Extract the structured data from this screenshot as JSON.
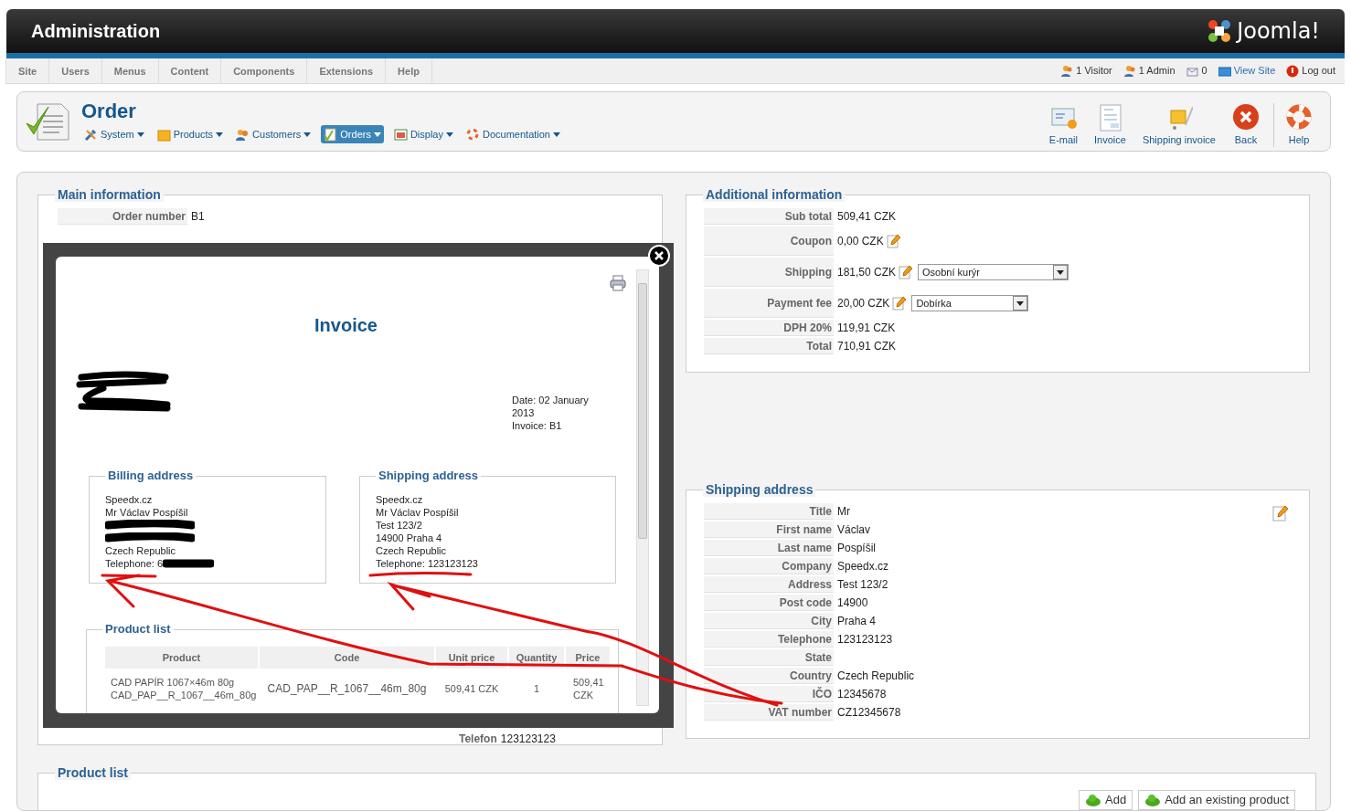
{
  "header": {
    "title": "Administration",
    "logo": "Joomla!"
  },
  "menu": [
    {
      "label": "Site"
    },
    {
      "label": "Users"
    },
    {
      "label": "Menus"
    },
    {
      "label": "Content"
    },
    {
      "label": "Components"
    },
    {
      "label": "Extensions"
    },
    {
      "label": "Help"
    }
  ],
  "status": [
    {
      "kind": "visitors",
      "label": "1 Visitor"
    },
    {
      "kind": "admins",
      "label": "1 Admin"
    },
    {
      "kind": "messages",
      "label": "0"
    },
    {
      "kind": "site",
      "label": "View Site"
    },
    {
      "kind": "logout",
      "label": "Log out"
    }
  ],
  "page": {
    "title": "Order",
    "submenu": [
      {
        "label": "System",
        "selected": false
      },
      {
        "label": "Products",
        "selected": false
      },
      {
        "label": "Customers",
        "selected": false
      },
      {
        "label": "Orders",
        "selected": true
      },
      {
        "label": "Display",
        "selected": false
      },
      {
        "label": "Documentation",
        "selected": false
      }
    ],
    "toolbar": [
      {
        "label": "E-mail"
      },
      {
        "label": "Invoice"
      },
      {
        "label": "Shipping invoice"
      },
      {
        "label": "Back"
      },
      {
        "label": "Help"
      }
    ]
  },
  "main_information": {
    "title": "Main information",
    "rows": [
      {
        "label": "Order number",
        "value": "B1"
      }
    ],
    "phone": {
      "label": "Telefon",
      "value": "123123123"
    }
  },
  "additional_information": {
    "title": "Additional information",
    "rows": [
      {
        "label": "Sub total",
        "value": "509,41 CZK",
        "editable": false
      },
      {
        "label": "Coupon",
        "value": "0,00 CZK",
        "editable": true
      },
      {
        "label": "Shipping",
        "value": "181,50 CZK",
        "editable": true,
        "select": "Osobní kurýr"
      },
      {
        "label": "Payment fee",
        "value": "20,00 CZK",
        "editable": true,
        "select": "Dobírka"
      },
      {
        "label": "DPH 20%",
        "value": "119,91 CZK",
        "editable": false
      },
      {
        "label": "Total",
        "value": "710,91 CZK",
        "editable": false
      }
    ]
  },
  "shipping_address": {
    "title": "Shipping address",
    "rows": [
      {
        "label": "Title",
        "value": "Mr"
      },
      {
        "label": "First name",
        "value": "Václav"
      },
      {
        "label": "Last name",
        "value": "Pospíšil"
      },
      {
        "label": "Company",
        "value": "Speedx.cz"
      },
      {
        "label": "Address",
        "value": "Test 123/2"
      },
      {
        "label": "Post code",
        "value": "14900"
      },
      {
        "label": "City",
        "value": "Praha 4"
      },
      {
        "label": "Telephone",
        "value": "123123123"
      },
      {
        "label": "State"
      },
      {
        "label": "Country",
        "value": "Czech Republic"
      },
      {
        "label": "IČO",
        "value": "12345678"
      },
      {
        "label": "VAT number",
        "value": "CZ12345678"
      }
    ]
  },
  "product_list": {
    "title": "Product list",
    "buttons": [
      "Add",
      "Add an existing product"
    ]
  },
  "invoice_modal": {
    "title": "Invoice",
    "sender_redacted": true,
    "details": [
      "Date: 02 January 2013",
      "Invoice: B1"
    ],
    "billing": {
      "title": "Billing address",
      "lines": [
        {
          "text": "Speedx.cz"
        },
        {
          "text": "Mr Václav Pospíšil"
        },
        {
          "redacted": true
        },
        {
          "redacted": true
        },
        {
          "text": "Czech Republic"
        },
        {
          "text": "Telephone: 6",
          "redacted": true
        }
      ]
    },
    "shipping": {
      "title": "Shipping address",
      "lines": [
        {
          "text": "Speedx.cz"
        },
        {
          "text": "Mr Václav Pospíšil"
        },
        {
          "text": "Test 123/2"
        },
        {
          "text": "14900 Praha 4"
        },
        {
          "text": "Czech Republic"
        },
        {
          "text": "Telephone: 123123123"
        }
      ]
    },
    "products": {
      "title": "Product list",
      "columns": [
        "Product",
        "Code",
        "Unit price",
        "Quantity",
        "Price"
      ],
      "rows": [
        {
          "product": [
            "CAD PAPÍR 1067×46m 80g",
            "CAD_PAP__R_1067__46m_80g"
          ],
          "code": "CAD_PAP__R_1067__46m_80g",
          "unit_price": "509,41 CZK",
          "quantity": "1",
          "price": "509,41 CZK"
        }
      ]
    }
  },
  "markup_arrows": true
}
